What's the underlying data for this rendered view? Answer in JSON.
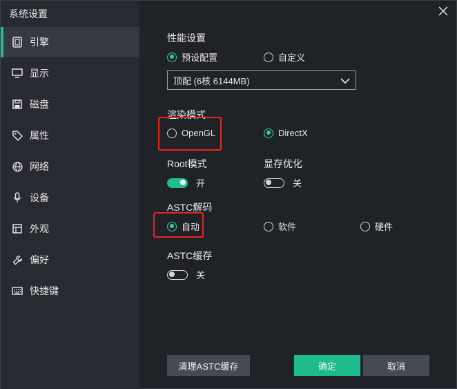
{
  "window": {
    "title": "系统设置"
  },
  "sidebar": {
    "items": [
      {
        "label": "引擎",
        "icon": "engine-icon",
        "active": true
      },
      {
        "label": "显示",
        "icon": "monitor-icon"
      },
      {
        "label": "磁盘",
        "icon": "disk-icon"
      },
      {
        "label": "属性",
        "icon": "tag-icon"
      },
      {
        "label": "网络",
        "icon": "globe-icon"
      },
      {
        "label": "设备",
        "icon": "microphone-icon"
      },
      {
        "label": "外观",
        "icon": "appearance-icon"
      },
      {
        "label": "偏好",
        "icon": "wrench-icon"
      },
      {
        "label": "快捷键",
        "icon": "keyboard-icon"
      }
    ]
  },
  "performance": {
    "title": "性能设置",
    "option_preset": "预设配置",
    "option_custom": "自定义",
    "selected": "预设配置",
    "dropdown_value": "顶配 (6核 6144MB)"
  },
  "render": {
    "title": "渲染模式",
    "option_opengl": "OpenGL",
    "option_directx": "DirectX",
    "selected": "DirectX"
  },
  "root": {
    "title": "Root模式",
    "state_label": "开",
    "on": true
  },
  "vram": {
    "title": "显存优化",
    "state_label": "关",
    "on": false
  },
  "astc_decode": {
    "title": "ASTC解码",
    "option_auto": "自动",
    "option_software": "软件",
    "option_hardware": "硬件",
    "selected": "自动"
  },
  "astc_cache": {
    "title": "ASTC缓存",
    "state_label": "关",
    "on": false
  },
  "buttons": {
    "clear_cache": "清理ASTC缓存",
    "confirm": "确定",
    "cancel": "取消"
  },
  "colors": {
    "accent": "#1ebc8c",
    "highlight": "#e8261f",
    "background": "#1f2328",
    "sidebar": "#272b31"
  }
}
